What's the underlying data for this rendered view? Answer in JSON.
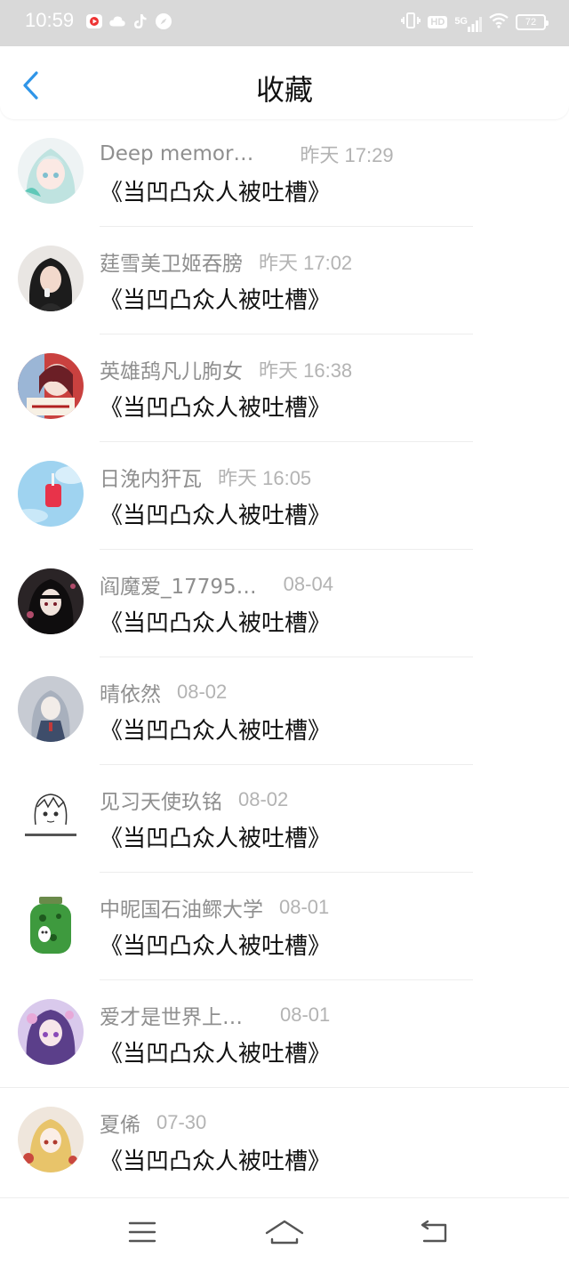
{
  "status_bar": {
    "time": "10:59",
    "hd": "HD",
    "network": "5G",
    "battery": "72",
    "app_icons": [
      "video-app-icon",
      "cloud-app-icon",
      "tiktok-app-icon",
      "compass-app-icon"
    ]
  },
  "header": {
    "title": "收藏",
    "accent_color": "#2f95e8"
  },
  "items": [
    {
      "username": "Deep memor…",
      "time": "昨天 17:29",
      "content": "《当凹凸众人被吐槽》",
      "avatar": "anime-girl-teal-hair-avatar"
    },
    {
      "username": "莛雪美卫姬吞膀",
      "time": "昨天 17:02",
      "content": "《当凹凸众人被吐槽》",
      "avatar": "girl-dark-hair-photo-avatar"
    },
    {
      "username": "英雄鸹凡儿朐女",
      "time": "昨天 16:38",
      "content": "《当凹凸众人被吐槽》",
      "avatar": "red-anime-girl-avatar"
    },
    {
      "username": "日浼内犴瓦",
      "time": "昨天 16:05",
      "content": "《当凹凸众人被吐槽》",
      "avatar": "red-drink-sky-avatar"
    },
    {
      "username": "阎魔爱_17795…",
      "time": "08-04",
      "content": "《当凹凸众人被吐槽》",
      "avatar": "dark-hair-anime-girl-avatar"
    },
    {
      "username": "晴依然",
      "time": "08-02",
      "content": "《当凹凸众人被吐槽》",
      "avatar": "gray-anime-character-avatar"
    },
    {
      "username": "见习天使玖铭",
      "time": "08-02",
      "content": "《当凹凸众人被吐槽》",
      "avatar": "sketch-anime-avatar"
    },
    {
      "username": "中昵国石油鳏大学",
      "time": "08-01",
      "content": "《当凹凸众人被吐槽》",
      "avatar": "green-jar-frog-avatar"
    },
    {
      "username": "爱才是世界上…",
      "time": "08-01",
      "content": "《当凹凸众人被吐槽》",
      "avatar": "purple-anime-girl-avatar"
    },
    {
      "username": "夏俙",
      "time": "07-30",
      "content": "《当凹凸众人被吐槽》",
      "avatar": "blonde-anime-avatar"
    }
  ],
  "navbar": {
    "icons": [
      "menu-icon",
      "home-icon",
      "back-nav-icon"
    ]
  }
}
